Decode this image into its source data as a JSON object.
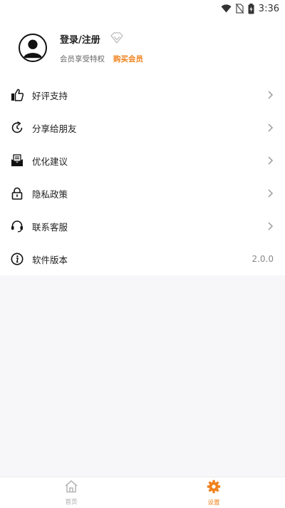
{
  "status_bar": {
    "time": "3:36",
    "icons": [
      "wifi-icon",
      "no-sim-icon",
      "battery-charging-icon"
    ]
  },
  "profile": {
    "login_label": "登录/注册",
    "member_text": "会员享受特权",
    "buy_member": "购买会员",
    "icons": [
      "avatar-icon",
      "diamond-icon"
    ]
  },
  "menu": {
    "items": [
      {
        "label": "好评支持",
        "icon": "thumbs-up-icon"
      },
      {
        "label": "分享给朋友",
        "icon": "share-refresh-icon"
      },
      {
        "label": "优化建议",
        "icon": "mail-icon"
      },
      {
        "label": "隐私政策",
        "icon": "lock-icon"
      },
      {
        "label": "联系客服",
        "icon": "headset-icon"
      },
      {
        "label": "软件版本",
        "icon": "info-icon",
        "value": "2.0.0"
      }
    ]
  },
  "bottom_nav": {
    "items": [
      {
        "label": "首页",
        "icon": "home-icon",
        "active": false
      },
      {
        "label": "设置",
        "icon": "gear-icon",
        "active": true
      }
    ]
  },
  "colors": {
    "accent": "#f0821e",
    "background": "#f7f7f9",
    "text": "#222222"
  }
}
